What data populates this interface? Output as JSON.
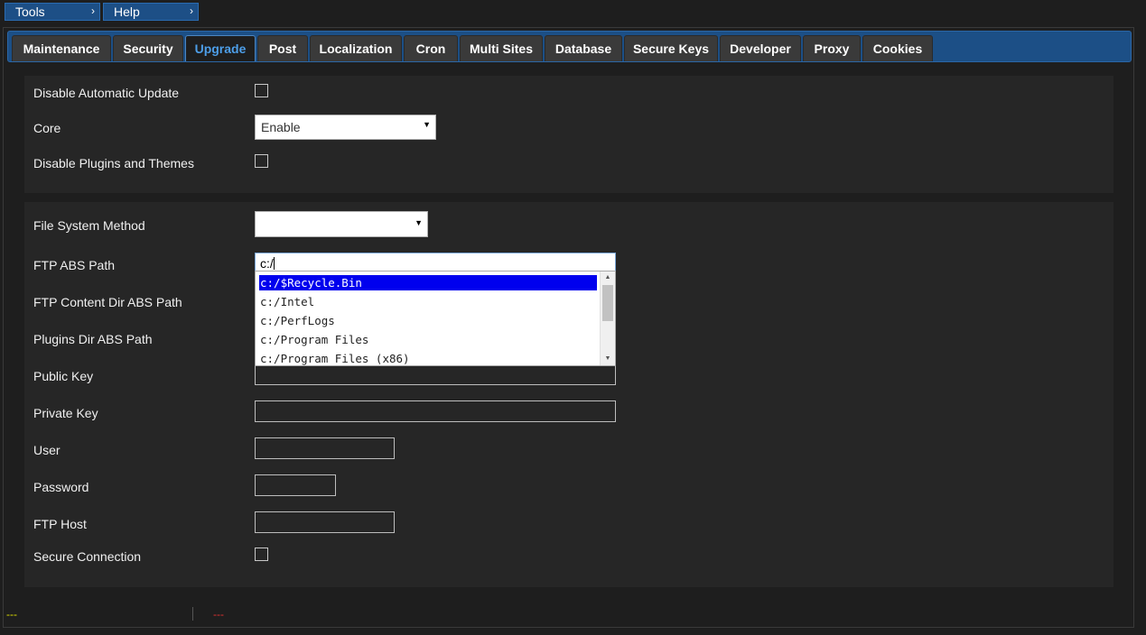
{
  "menubar": {
    "tools_label": "Tools",
    "help_label": "Help",
    "arrow": "›"
  },
  "tabs": [
    {
      "label": "Maintenance"
    },
    {
      "label": "Security"
    },
    {
      "label": "Upgrade",
      "active": true
    },
    {
      "label": "Post"
    },
    {
      "label": "Localization"
    },
    {
      "label": "Cron"
    },
    {
      "label": "Multi Sites"
    },
    {
      "label": "Database"
    },
    {
      "label": "Secure Keys"
    },
    {
      "label": "Developer"
    },
    {
      "label": "Proxy"
    },
    {
      "label": "Cookies"
    }
  ],
  "panel1": {
    "disable_auto_update_label": "Disable Automatic Update",
    "disable_auto_update_checked": false,
    "core_label": "Core",
    "core_value": "Enable",
    "disable_plugins_label": "Disable Plugins and Themes",
    "disable_plugins_checked": false
  },
  "panel2": {
    "fs_method_label": "File System Method",
    "fs_method_value": "",
    "ftp_abs_path_label": "FTP ABS Path",
    "ftp_abs_path_value": "c:/",
    "ftp_content_dir_label": "FTP Content Dir ABS Path",
    "plugins_dir_label": "Plugins Dir ABS Path",
    "public_key_label": "Public Key",
    "private_key_label": "Private Key",
    "user_label": "User",
    "password_label": "Password",
    "ftp_host_label": "FTP Host",
    "secure_connection_label": "Secure Connection",
    "secure_connection_checked": false
  },
  "autocomplete": {
    "items": [
      "c:/$Recycle.Bin",
      "c:/Intel",
      "c:/PerfLogs",
      "c:/Program Files",
      "c:/Program Files (x86)"
    ],
    "selected_index": 0
  },
  "status": {
    "left": "---",
    "right": "---"
  },
  "colors": {
    "accent": "#1d4f86",
    "active_tab_text": "#4d9ee8",
    "selection": "#0000ee",
    "status_left": "#e0e000",
    "status_right": "#e03030"
  }
}
